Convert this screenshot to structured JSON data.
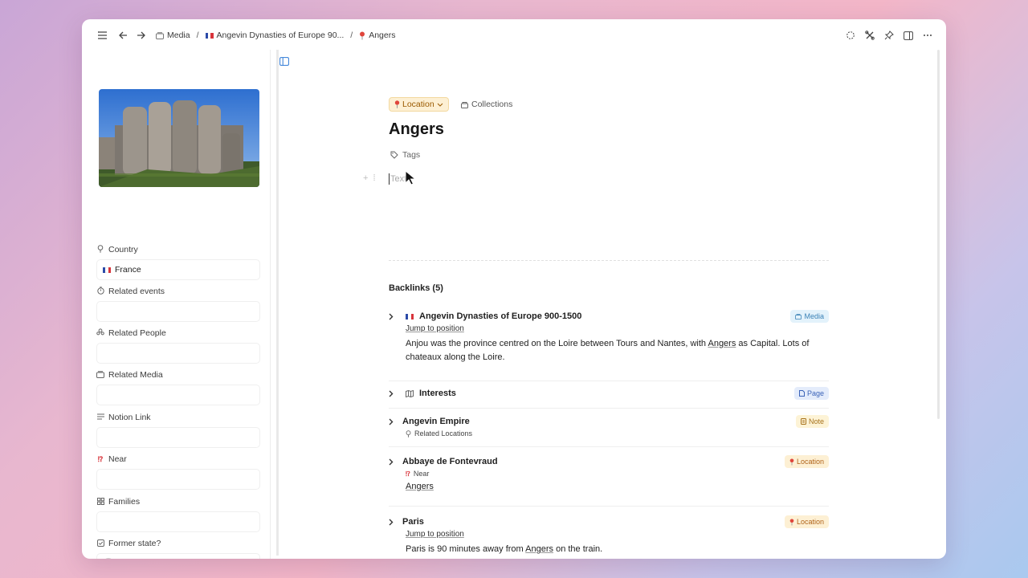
{
  "breadcrumb": [
    {
      "label": "Media",
      "icon": "media-icon"
    },
    {
      "label": "Angevin Dynasties of Europe 90...",
      "icon": "flag-icon"
    },
    {
      "label": "Angers",
      "icon": "pin-icon"
    }
  ],
  "sidebar": {
    "properties": [
      {
        "label": "Country",
        "value": "France",
        "icon": "pin-outline-icon"
      },
      {
        "label": "Related events",
        "value": "",
        "icon": "stopwatch-icon"
      },
      {
        "label": "Related People",
        "value": "",
        "icon": "people-icon"
      },
      {
        "label": "Related Media",
        "value": "",
        "icon": "media-icon"
      },
      {
        "label": "Notion Link",
        "value": "",
        "icon": "lines-icon"
      },
      {
        "label": "Near",
        "value": "",
        "icon": "near-icon"
      },
      {
        "label": "Families",
        "value": "",
        "icon": "grid-icon"
      },
      {
        "label": "Former state?",
        "value": "",
        "icon": "checkbox-icon"
      }
    ]
  },
  "page": {
    "type_label": "Location",
    "collections_label": "Collections",
    "title": "Angers",
    "tags_label": "Tags",
    "placeholder": "Text"
  },
  "backlinks": {
    "heading": "Backlinks (5)",
    "items": [
      {
        "title": "Angevin Dynasties of Europe 900-1500",
        "badge": "Media",
        "jump": "Jump to position",
        "text_before": "Anjou was the province centred on the Loire between Tours and Nantes, with ",
        "link": "Angers",
        "text_after": " as Capital. Lots of chateaux along the Loire."
      },
      {
        "title": "Interests",
        "badge": "Page"
      },
      {
        "title": "Angevin Empire",
        "badge": "Note",
        "meta": "Related Locations"
      },
      {
        "title": "Abbaye de Fontevraud",
        "badge": "Location",
        "meta": "Near",
        "link": "Angers"
      },
      {
        "title": "Paris",
        "badge": "Location",
        "jump": "Jump to position",
        "text_before": "Paris is 90 minutes away from ",
        "link": "Angers",
        "text_after": " on the train."
      }
    ]
  },
  "colors": {
    "accent": "#2f7ad6",
    "location_badge": "#fdf0d4",
    "flag_blue": "#2b4aa8",
    "flag_red": "#d8343b"
  }
}
